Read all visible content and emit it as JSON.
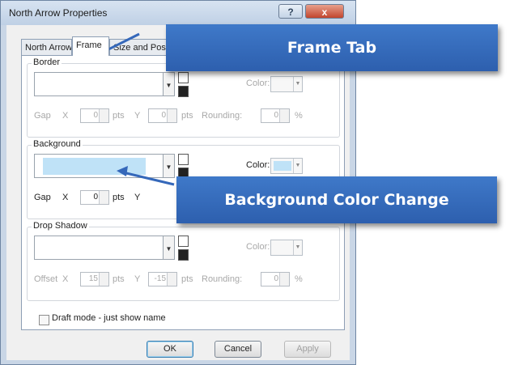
{
  "dialog": {
    "title": "North Arrow Properties",
    "help_label": "?",
    "close_label": "x",
    "tabs": [
      {
        "label": "North Arrow",
        "active": false
      },
      {
        "label": "Frame",
        "active": true
      },
      {
        "label": "Size and Position",
        "active": false
      }
    ],
    "border": {
      "label": "Border",
      "color_label": "Color:",
      "gap_label": "Gap",
      "x_label": "X",
      "x_value": "0",
      "pts1": "pts",
      "y_label": "Y",
      "y_value": "0",
      "pts2": "pts",
      "rounding_label": "Rounding:",
      "rounding_value": "0",
      "percent": "%"
    },
    "background": {
      "label": "Background",
      "color_label": "Color:",
      "fill_color": "#bfe2f7",
      "gap_label": "Gap",
      "x_label": "X",
      "x_value": "0",
      "pts1": "pts",
      "y_label": "Y"
    },
    "drop_shadow": {
      "label": "Drop Shadow",
      "color_label": "Color:",
      "offset_label": "Offset",
      "x_label": "X",
      "x_value": "15",
      "pts1": "pts",
      "y_label": "Y",
      "y_value": "-15",
      "pts2": "pts",
      "rounding_label": "Rounding:",
      "rounding_value": "0",
      "percent": "%"
    },
    "draft_mode_label": "Draft mode - just show name",
    "draft_mode_checked": false,
    "buttons": {
      "ok": "OK",
      "cancel": "Cancel",
      "apply": "Apply"
    }
  },
  "callouts": {
    "frame_tab": "Frame Tab",
    "background_color": "Background Color Change",
    "color": "#3568ba"
  }
}
